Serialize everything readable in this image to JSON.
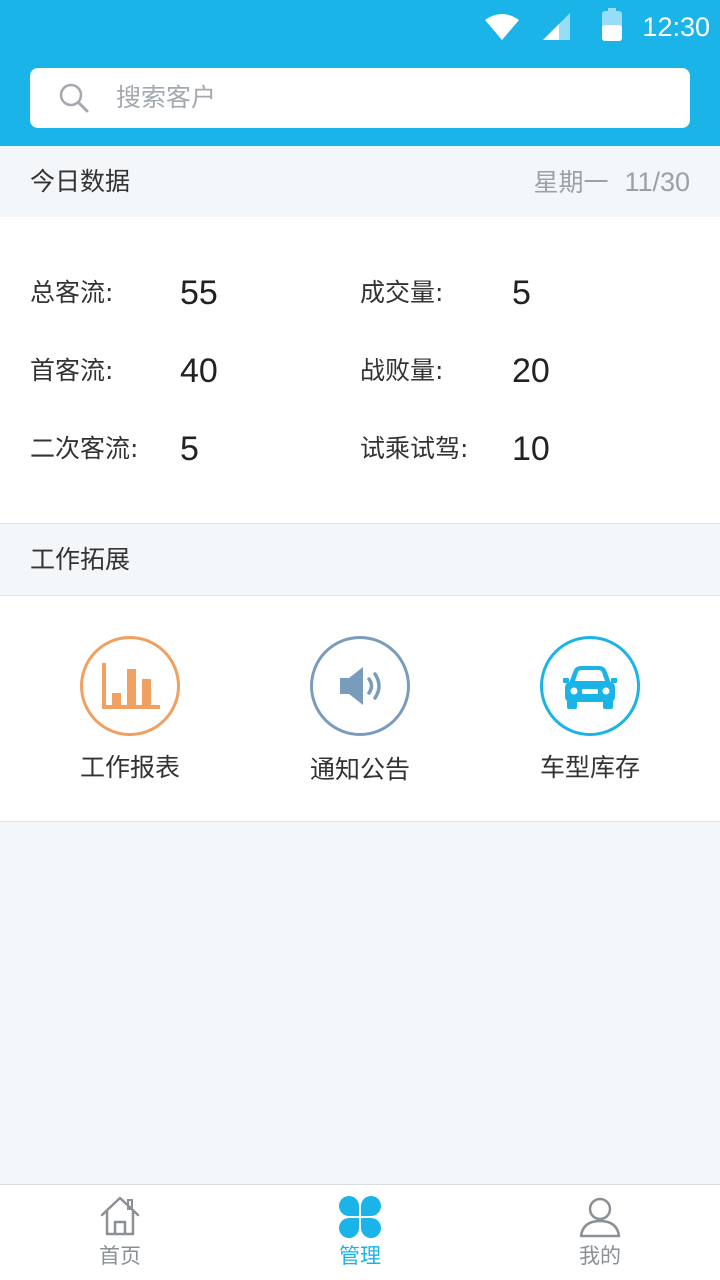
{
  "status_bar": {
    "time": "12:30",
    "icons": [
      "wifi-icon",
      "signal-icon",
      "battery-icon"
    ]
  },
  "search": {
    "placeholder": "搜索客户",
    "icon": "search-icon"
  },
  "today": {
    "title": "今日数据",
    "weekday": "星期一",
    "date": "11/30",
    "stats": [
      {
        "label": "总客流:",
        "value": "55"
      },
      {
        "label": "成交量:",
        "value": "5"
      },
      {
        "label": "首客流:",
        "value": "40"
      },
      {
        "label": "战败量:",
        "value": "20"
      },
      {
        "label": "二次客流:",
        "value": "5"
      },
      {
        "label": "试乘试驾:",
        "value": "10"
      }
    ]
  },
  "work": {
    "title": "工作拓展",
    "tools": [
      {
        "label": "工作报表",
        "icon": "bar-chart-icon",
        "color": "#f0a060"
      },
      {
        "label": "通知公告",
        "icon": "speaker-icon",
        "color": "#7a9cbc"
      },
      {
        "label": "车型库存",
        "icon": "car-icon",
        "color": "#1ab4e8"
      }
    ]
  },
  "tabbar": {
    "active": 1,
    "tabs": [
      {
        "label": "首页",
        "icon": "home-icon"
      },
      {
        "label": "管理",
        "icon": "clover-grid-icon"
      },
      {
        "label": "我的",
        "icon": "user-icon"
      }
    ]
  },
  "colors": {
    "primary": "#1ab4e8",
    "background": "#f3f7fa",
    "muted_text": "#9aa1a7",
    "tab_inactive": "#8a9095"
  }
}
